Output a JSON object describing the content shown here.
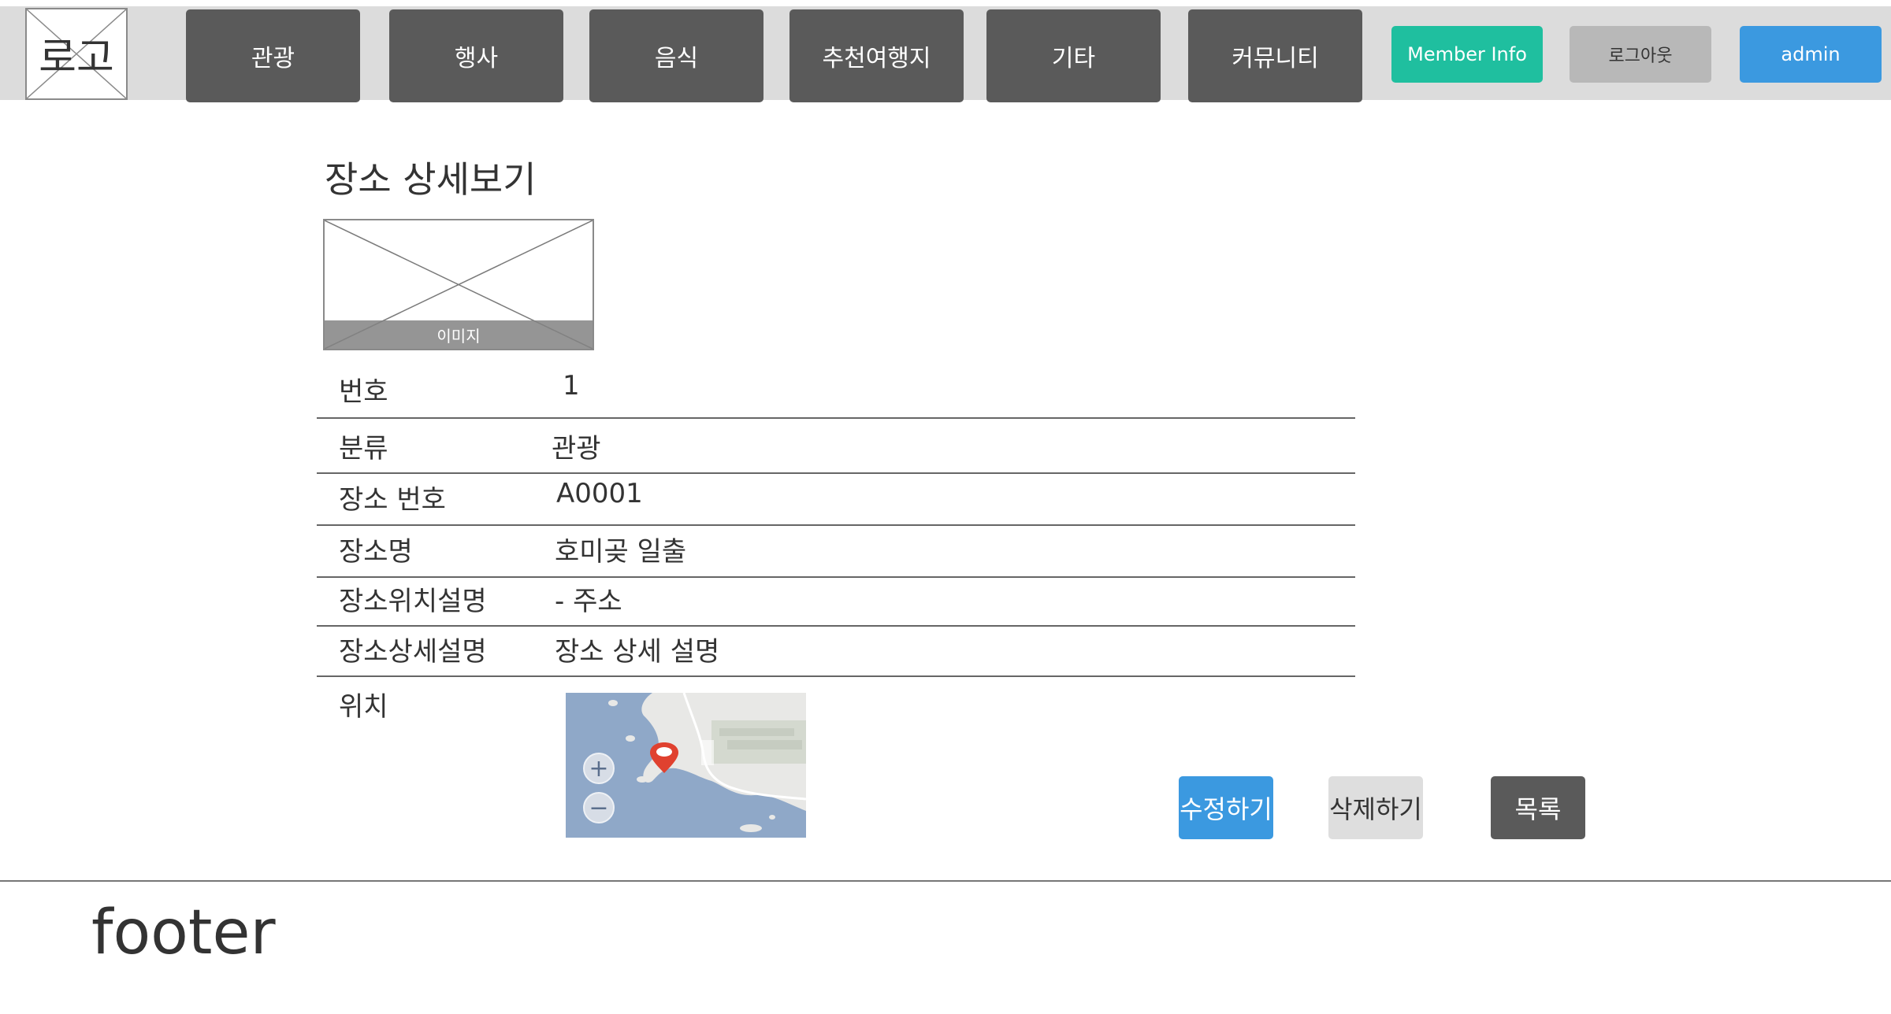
{
  "header": {
    "logo_text": "로고",
    "nav": [
      "관광",
      "행사",
      "음식",
      "추천여행지",
      "기타",
      "커뮤니티"
    ],
    "member_info_label": "Member Info",
    "logout_label": "로그아웃",
    "admin_label": "admin"
  },
  "main": {
    "title": "장소 상세보기",
    "image_caption": "이미지",
    "fields": {
      "number_label": "번호",
      "number_value": "1",
      "category_label": "분류",
      "category_value": "관광",
      "place_no_label": "장소 번호",
      "place_no_value": "A0001",
      "place_name_label": "장소명",
      "place_name_value": "호미곶 일출",
      "location_desc_label": "장소위치설명",
      "location_desc_value": "- 주소",
      "detail_desc_label": "장소상세설명",
      "detail_desc_value": "장소 상세 설명",
      "location_label": "위치"
    },
    "map": {
      "zoom_in": "+",
      "zoom_out": "−"
    },
    "actions": {
      "edit": "수정하기",
      "delete": "삭제하기",
      "list": "목록"
    }
  },
  "footer": {
    "text": "footer"
  },
  "colors": {
    "header_bg": "#dcdcdc",
    "nav_bg": "#5a5a5a",
    "member_info": "#1fbf9f",
    "logout": "#b8b8b8",
    "admin": "#3b99e0",
    "edit": "#3b99e0",
    "delete": "#dedede",
    "list": "#5a5a5a"
  }
}
